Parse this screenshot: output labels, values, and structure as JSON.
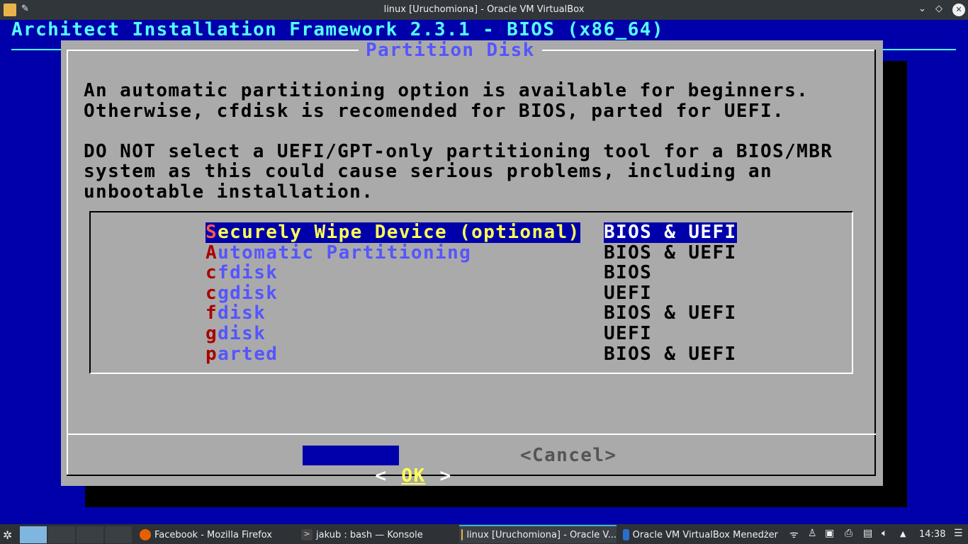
{
  "window": {
    "title": "linux [Uruchomiona] - Oracle VM VirtualBox",
    "buttons": {
      "minimize": "⌄",
      "maximize": "◇",
      "close": "✕"
    }
  },
  "vm": {
    "header": "Architect Installation Framework 2.3.1 - BIOS (x86_64)",
    "dialog": {
      "title": "Partition Disk",
      "text": [
        "An automatic partitioning option is available for beginners.",
        "Otherwise, cfdisk is recomended for BIOS, parted for UEFI.",
        "",
        "DO NOT select a UEFI/GPT-only partitioning tool for a BIOS/MBR",
        "system as this could cause serious problems, including an",
        "unbootable installation."
      ],
      "items": [
        {
          "hotkey": "S",
          "rest": "ecurely Wipe Device (optional)",
          "desc": "BIOS & UEFI",
          "selected": true
        },
        {
          "hotkey": "A",
          "rest": "utomatic Partitioning",
          "desc": "BIOS & UEFI"
        },
        {
          "hotkey": "c",
          "rest": "fdisk",
          "desc": "BIOS"
        },
        {
          "hotkey": "c",
          "rest": "gdisk",
          "desc": "UEFI"
        },
        {
          "hotkey": "f",
          "rest": "disk",
          "desc": "BIOS & UEFI"
        },
        {
          "hotkey": "g",
          "rest": "disk",
          "desc": "UEFI"
        },
        {
          "hotkey": "p",
          "rest": "arted",
          "desc": "BIOS & UEFI"
        }
      ],
      "ok": {
        "left": "<",
        "label": "OK",
        "right": ">"
      },
      "cancel": "<Cancel>"
    }
  },
  "taskbar": {
    "tasks": [
      {
        "label": "Facebook - Mozilla Firefox"
      },
      {
        "label": "jakub : bash — Konsole"
      },
      {
        "label": "linux [Uruchomiona] - Oracle V..."
      },
      {
        "label": "Oracle VM VirtualBox Menedżer"
      }
    ],
    "clock": "14:38"
  },
  "colors": {
    "vm_bg": "#0000aa",
    "dialog": "#aaaaaa",
    "accent": "#ffff55"
  }
}
